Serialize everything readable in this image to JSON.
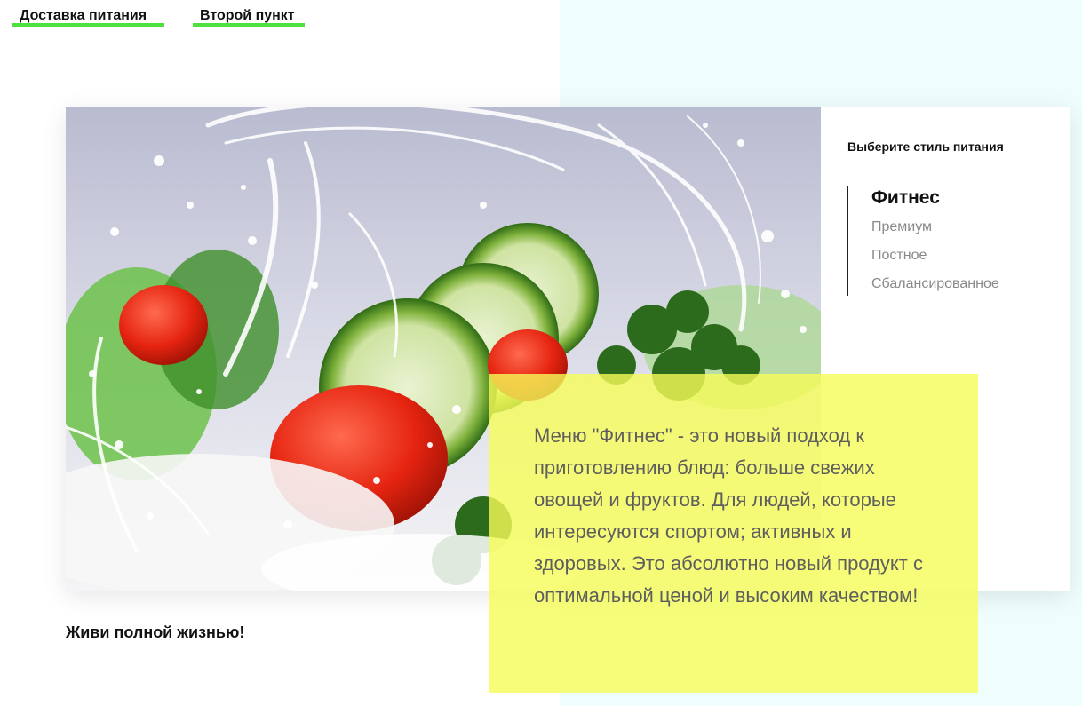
{
  "nav": {
    "items": [
      {
        "label": "Доставка питания"
      },
      {
        "label": "Второй пункт"
      }
    ]
  },
  "menu": {
    "title": "Выберите стиль питания",
    "items": [
      {
        "label": "Фитнес",
        "active": true
      },
      {
        "label": "Премиум",
        "active": false
      },
      {
        "label": "Постное",
        "active": false
      },
      {
        "label": "Сбалансированное",
        "active": false
      }
    ]
  },
  "slogan": "Живи полной жизнью!",
  "description": "Меню \"Фитнес\" - это новый подход к приготовлению блюд: больше свежих овощей и фруктов. Для людей, которые интересуются спортом; активных и здоровых. Это абсолютно новый продукт с оптимальной ценой и высоким качеством!",
  "colors": {
    "nav_underline": "#4fe040",
    "right_background": "#effdfd",
    "description_box": "#f6fc58"
  }
}
